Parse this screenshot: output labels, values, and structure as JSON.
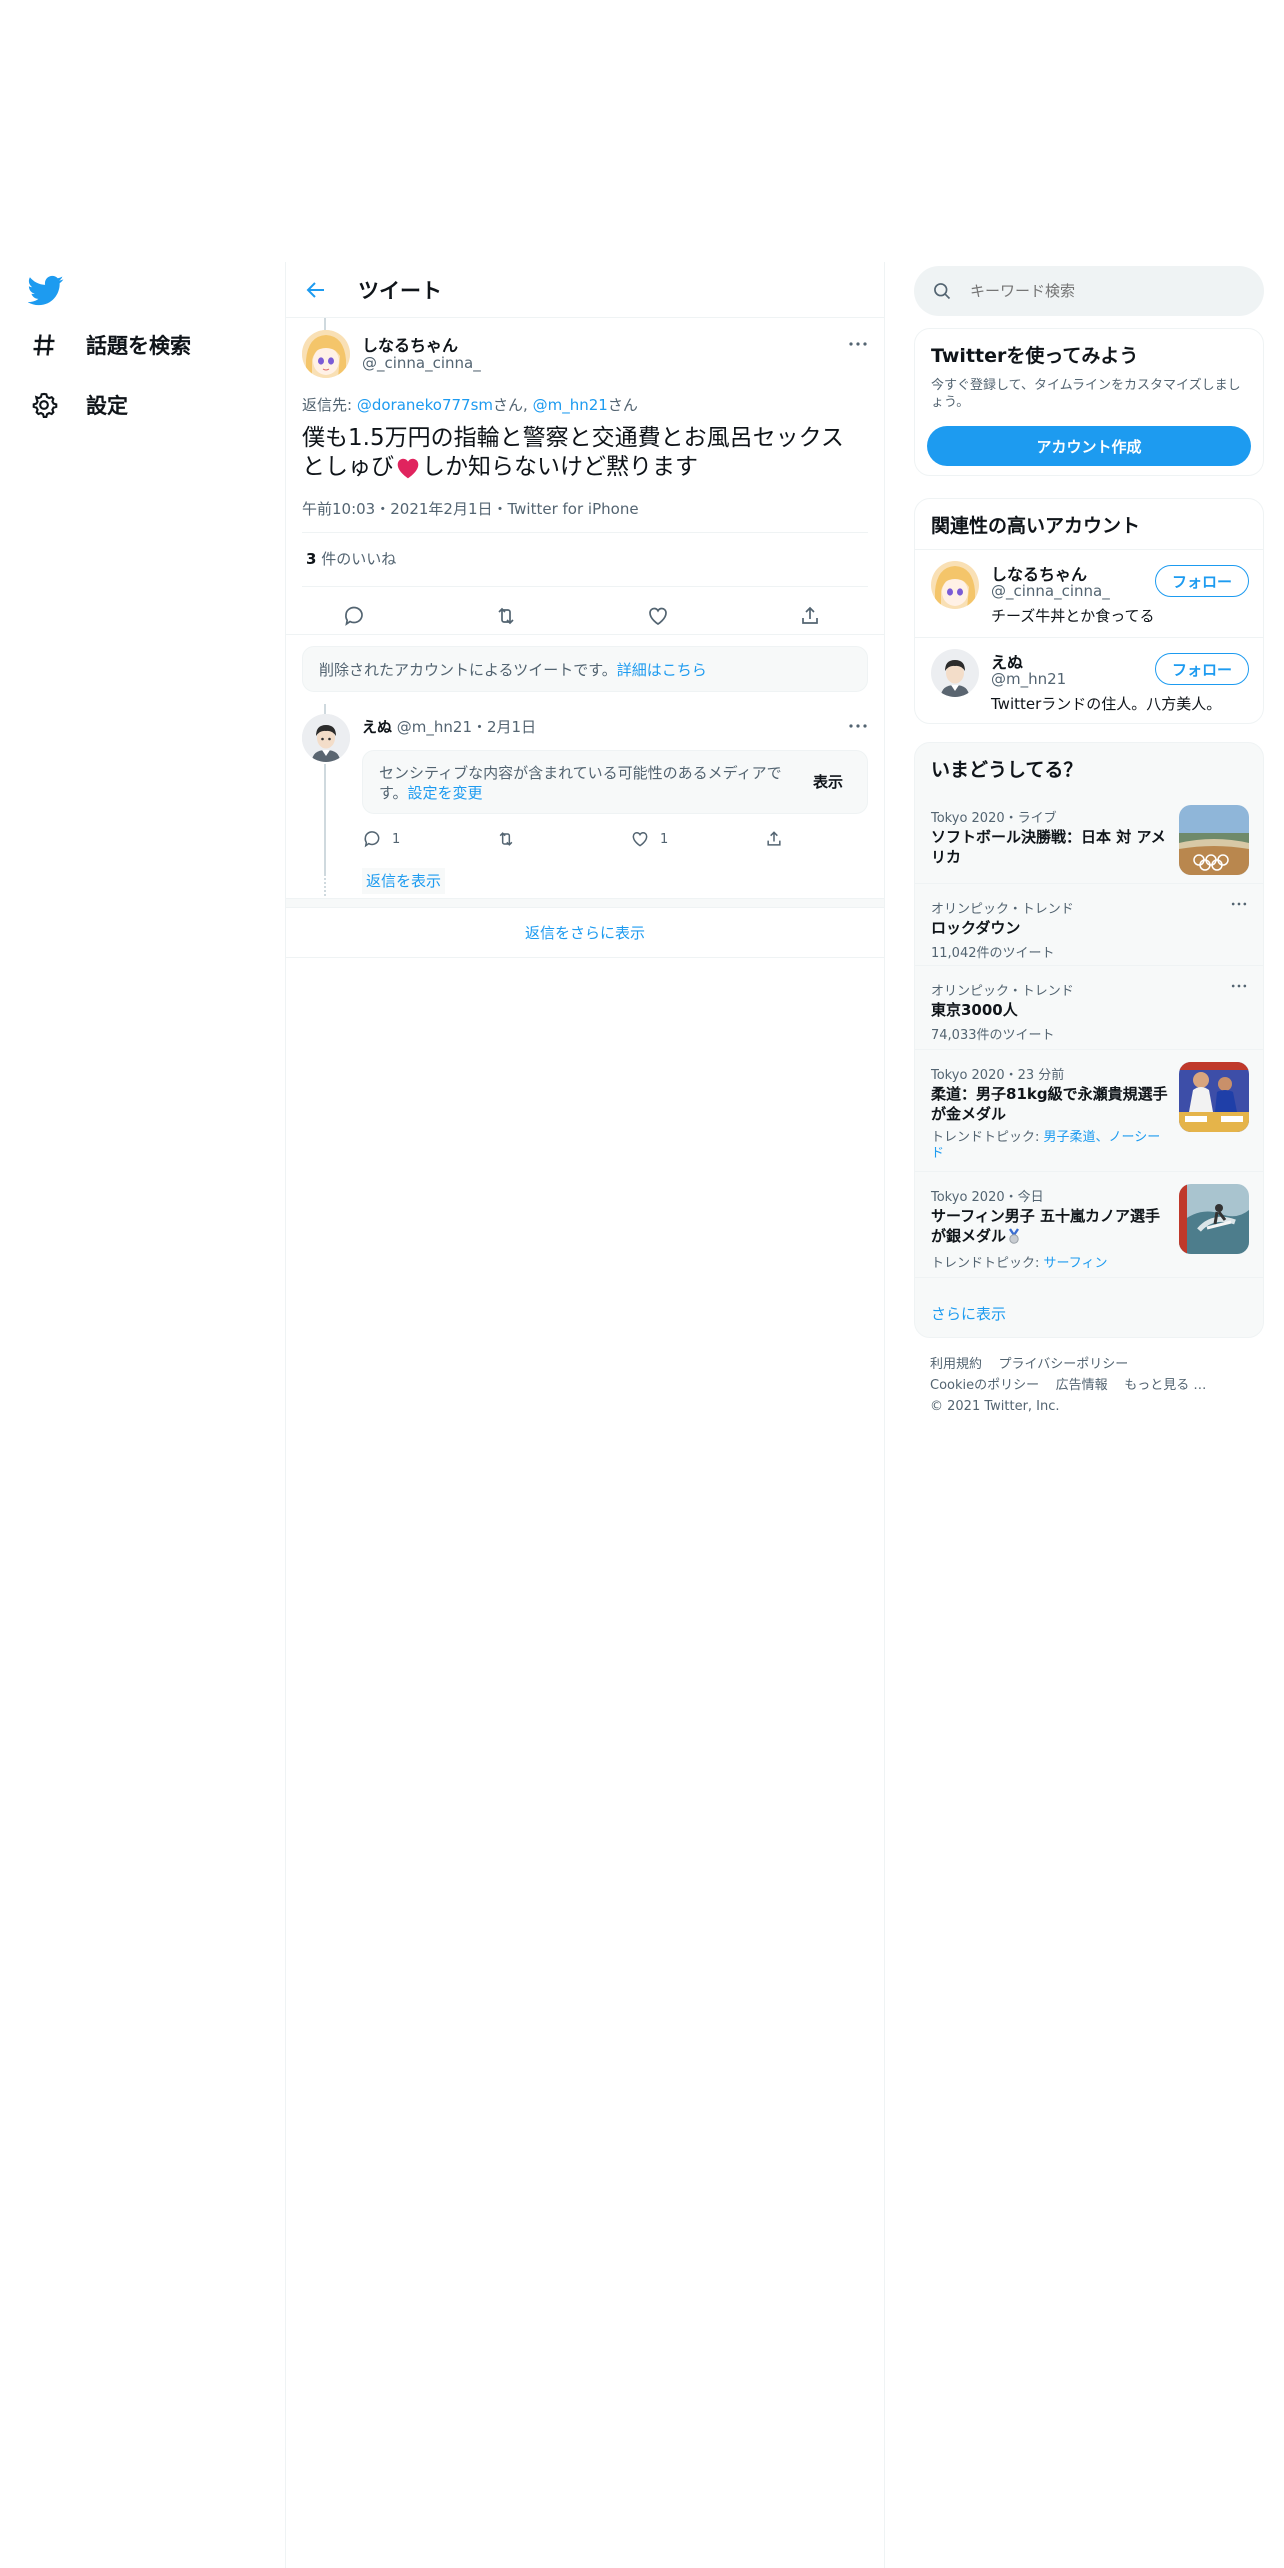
{
  "nav": {
    "items": [
      {
        "label": "話題を検索",
        "icon": "hashtag-icon"
      },
      {
        "label": "設定",
        "icon": "gear-icon"
      }
    ]
  },
  "header": {
    "title": "ツイート"
  },
  "tweet": {
    "name": "しなるちゃん",
    "handle": "@_cinna_cinna_",
    "reply_prefix": "返信先:",
    "reply_to_1": "@doraneko777sm",
    "reply_suffix_1": "さん,",
    "reply_to_2": "@m_hn21",
    "reply_suffix_2": "さん",
    "text_line1": "僕も1.5万円の指輪と警察と交通費とお風呂セックス",
    "text_line2_a": "としゅび",
    "text_line2_b": "しか知らないけど黙ります",
    "meta": "午前10:03・2021年2月1日・Twitter for iPhone",
    "likes_count": "3",
    "likes_label": "件のいいね"
  },
  "deleted_notice": {
    "text": "削除されたアカウントによるツイートです。",
    "link": "詳細はこちら"
  },
  "reply": {
    "name": "えぬ",
    "handle": "@m_hn21",
    "date": "・2月1日",
    "sensitive_text_1": "センシティブな内容が含まれている可能性のあるメディアで",
    "sensitive_text_2": "す。",
    "sensitive_link": "設定を変更",
    "show_button": "表示",
    "reply_count": "1",
    "like_count": "1",
    "show_replies": "返信を表示"
  },
  "more_replies": "返信をさらに表示",
  "search": {
    "placeholder": "キーワード検索"
  },
  "signup": {
    "title": "Twitterを使ってみよう",
    "desc_1": "今すぐ登録して、タイムラインをカスタマイズしまし",
    "desc_2": "ょう。",
    "button": "アカウント作成"
  },
  "relevant": {
    "title": "関連性の高いアカウント",
    "accounts": [
      {
        "name": "しなるちゃん",
        "handle": "@_cinna_cinna_",
        "bio": "チーズ牛丼とか食ってる",
        "follow": "フォロー"
      },
      {
        "name": "えぬ",
        "handle": "@m_hn21",
        "bio": "Twitterランドの住人。八方美人。",
        "follow": "フォロー"
      }
    ]
  },
  "trends": {
    "title": "いまどうしてる？",
    "items": [
      {
        "meta": "Tokyo 2020・ライブ",
        "title_1": "ソフトボール決勝戦：日本 対 アメ",
        "title_2": "リカ"
      },
      {
        "meta": "オリンピック・トレンド",
        "title_1": "ロックダウン",
        "count": "11,042件のツイート"
      },
      {
        "meta": "オリンピック・トレンド",
        "title_1": "東京3000人",
        "count": "74,033件のツイート"
      },
      {
        "meta": "Tokyo 2020・23 分前",
        "title_1": "柔道：男子81kg級で永瀬貴規選手",
        "title_2": "が金メダル",
        "topic_label": "トレンドトピック:",
        "topic_1": "男子柔道、ノーシー",
        "topic_2": "ド"
      },
      {
        "meta": "Tokyo 2020・今日",
        "title_1": "サーフィン男子 五十嵐カノア選手",
        "title_2": "が銀メダル",
        "topic_label": "トレンドトピック:",
        "topic_1": "サーフィン"
      }
    ],
    "show_more": "さらに表示"
  },
  "footer": {
    "links_1": [
      "利用規約",
      "プライバシーポリシー"
    ],
    "links_2": [
      "Cookieのポリシー",
      "広告情報",
      "もっと見る …"
    ],
    "copyright": "© 2021 Twitter, Inc."
  },
  "colors": {
    "accent": "#1d9bf0",
    "text": "#0f1419",
    "secondary": "#536471",
    "border": "#eff3f4",
    "heart": "#e0245e"
  }
}
